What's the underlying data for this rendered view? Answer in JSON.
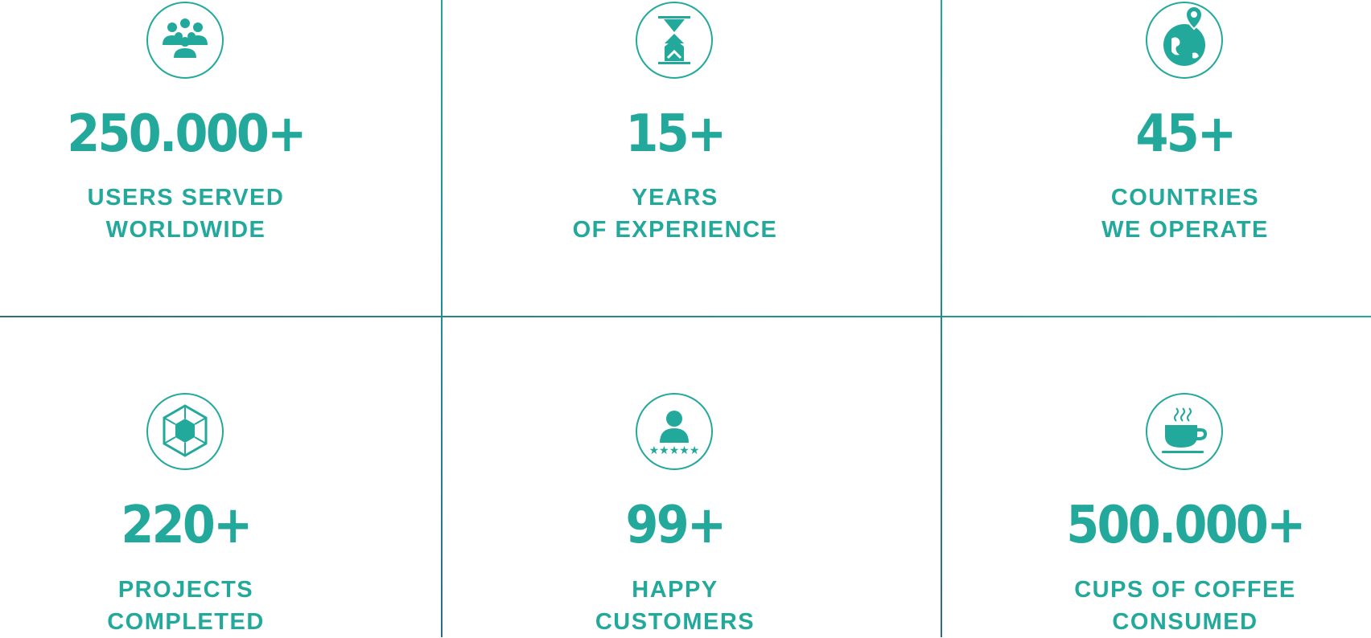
{
  "stats": [
    {
      "icon": "users-group-icon",
      "value": "250.000+",
      "label_line1": "USERS SERVED",
      "label_line2": "WORLDWIDE"
    },
    {
      "icon": "hourglass-icon",
      "value": "15+",
      "label_line1": "YEARS",
      "label_line2": "OF EXPERIENCE"
    },
    {
      "icon": "globe-pin-icon",
      "value": "45+",
      "label_line1": "COUNTRIES",
      "label_line2": "WE OPERATE"
    },
    {
      "icon": "cube-icon",
      "value": "220+",
      "label_line1": "PROJECTS",
      "label_line2": "COMPLETED"
    },
    {
      "icon": "customer-rating-icon",
      "value": "99+",
      "label_line1": "HAPPY",
      "label_line2": "CUSTOMERS"
    },
    {
      "icon": "coffee-cup-icon",
      "value": "500.000+",
      "label_line1": "CUPS OF COFFEE",
      "label_line2": "CONSUMED"
    }
  ],
  "colors": {
    "accent": "#23a99b",
    "divider_dark": "#2d6e86"
  }
}
